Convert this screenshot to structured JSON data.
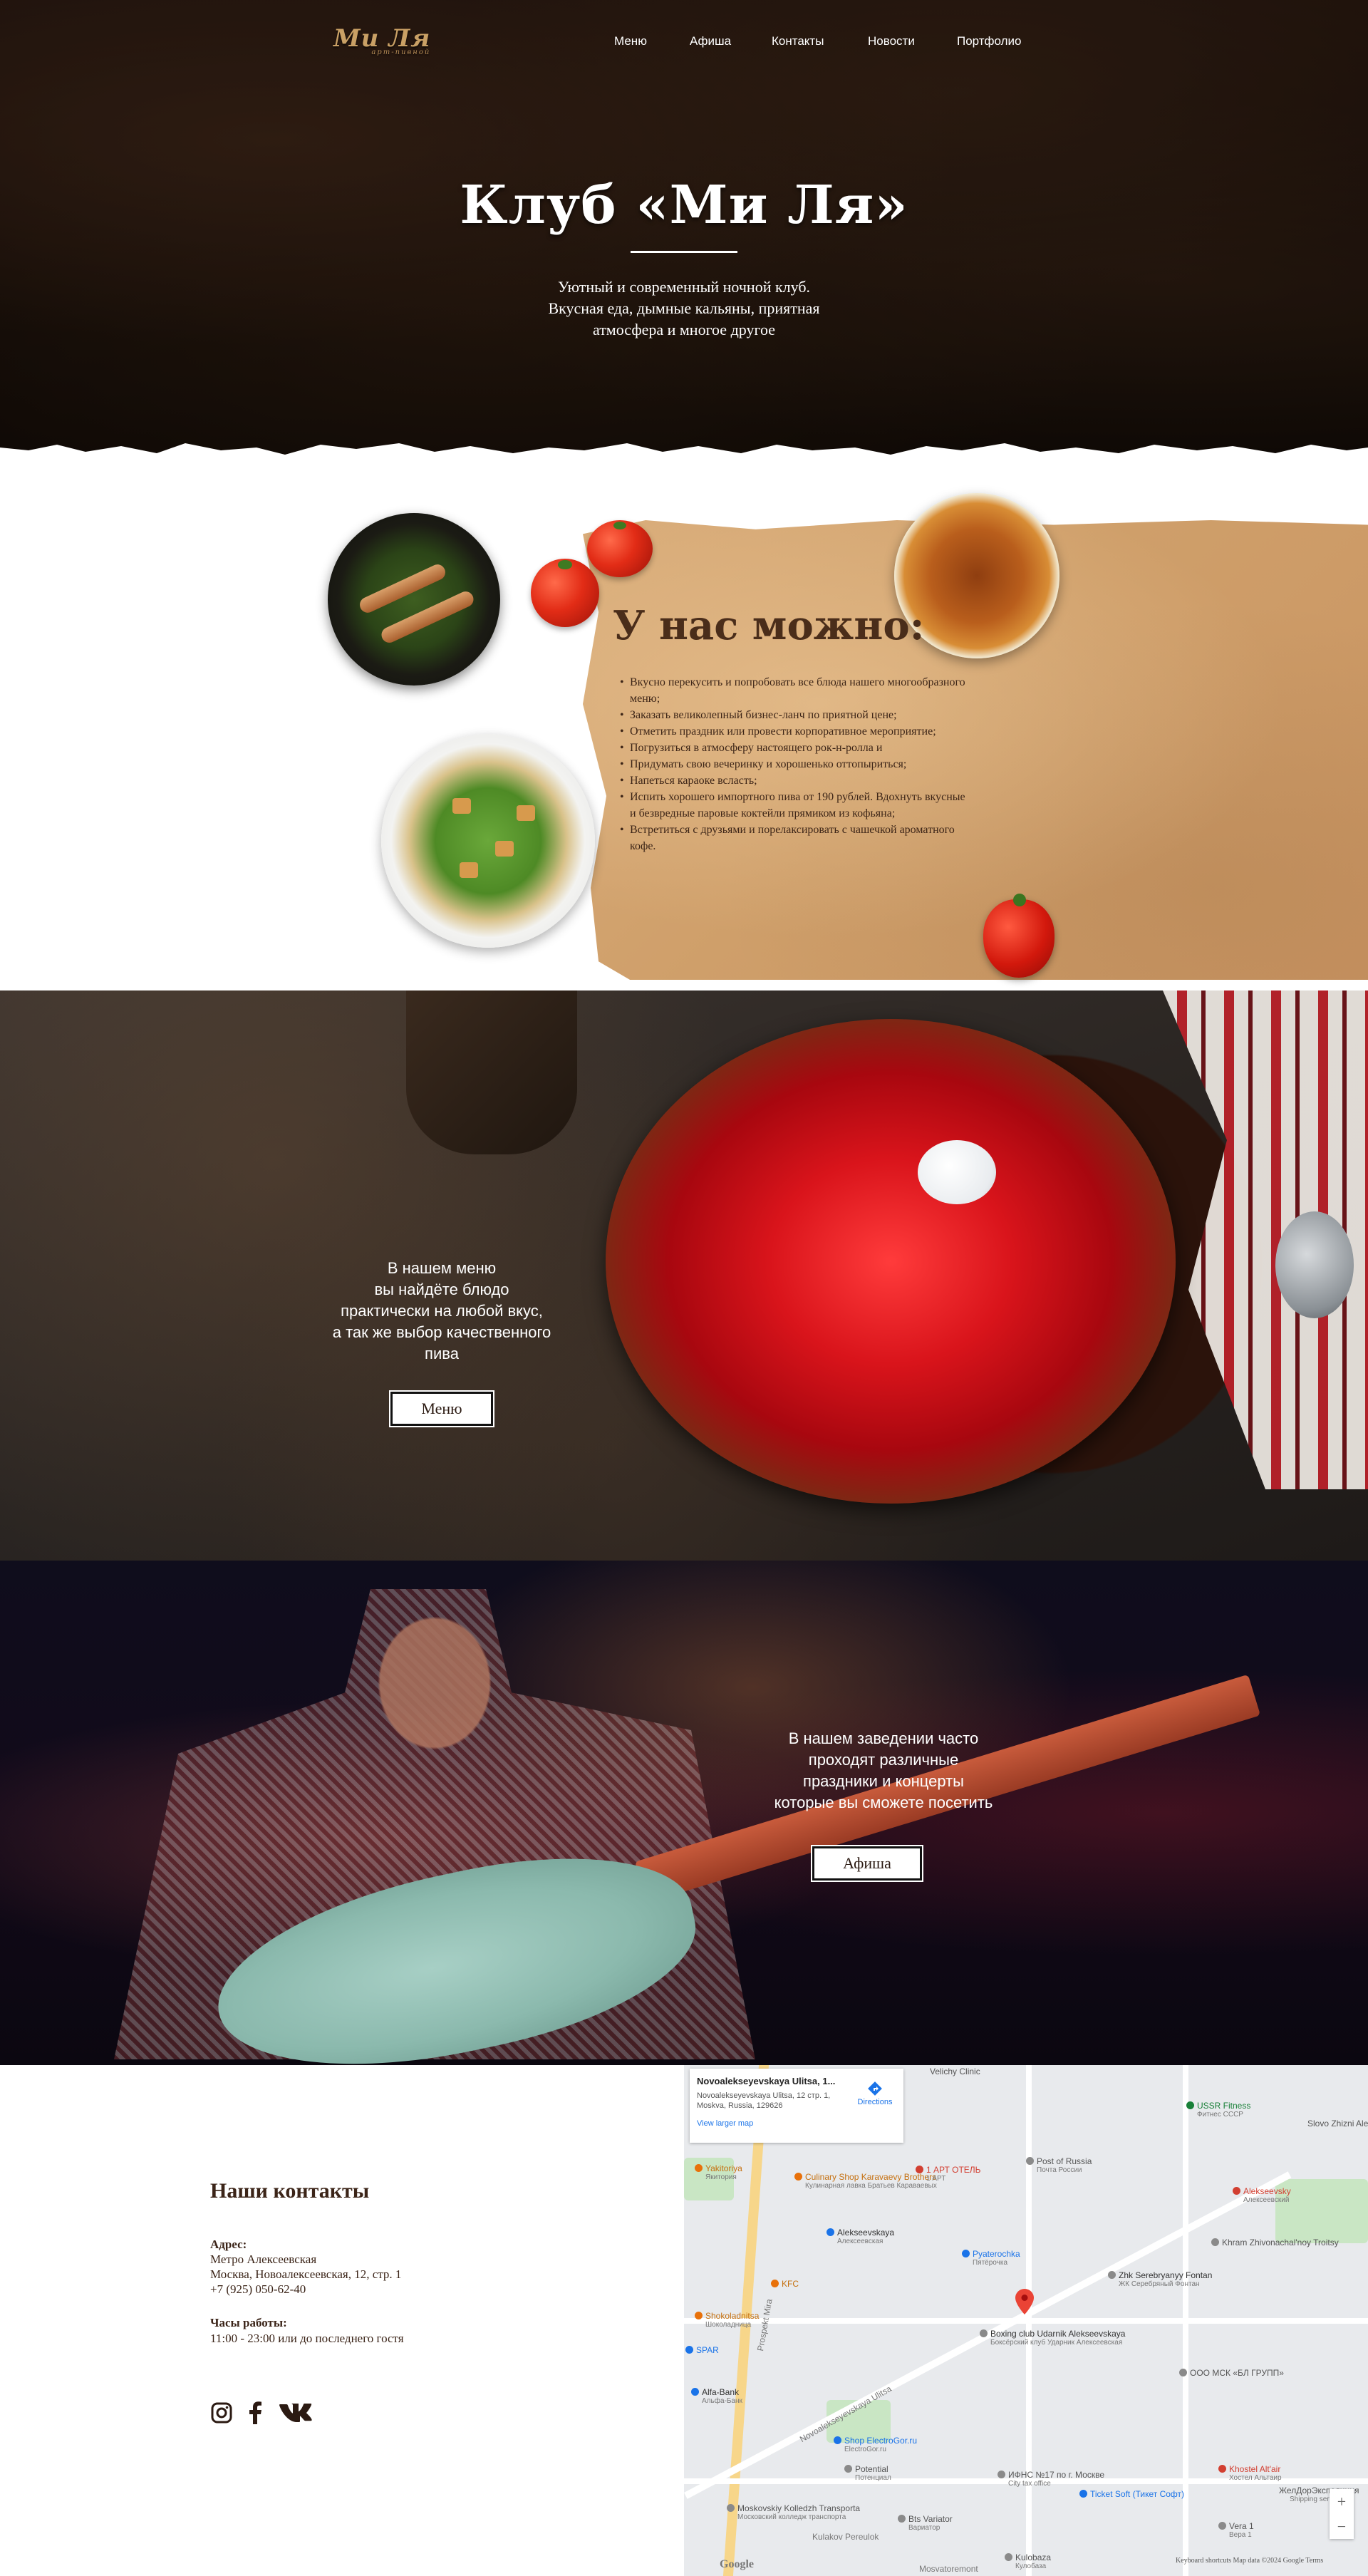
{
  "header": {
    "logo_text": "Ми Ля",
    "logo_tagline": "арт-пивной",
    "nav": [
      "Меню",
      "Афиша",
      "Контакты",
      "Новости",
      "Портфолио"
    ]
  },
  "hero": {
    "title": "Клуб «Ми Ля»",
    "subtitle": [
      "Уютный и современный ночной клуб.",
      "Вкусная еда, дымные кальяны, приятная",
      "атмосфера и многое другое"
    ]
  },
  "can": {
    "title": "У нас можно:",
    "items": [
      "Вкусно перекусить и попробовать все блюда нашего многообразного меню;",
      "Заказать великолепный бизнес-ланч по приятной цене;",
      "Отметить праздник или провести корпоративное мероприятие;",
      "Погрузиться в атмосферу настоящего рок-н-ролла и",
      "Придумать свою вечеринку и хорошенько оттопыриться;",
      "Напеться караоке всласть;",
      "Испить хорошего импортного пива от 190 рублей. Вдохнуть вкусные и безвредные паровые коктейли прямиком из кофьяна;",
      "Встретиться с друзьями и порелаксировать с чашечкой ароматного кофе."
    ]
  },
  "menu_section": {
    "text": [
      "В нашем меню",
      "вы найдёте блюдо",
      "практически на любой вкус,",
      "а так же выбор качественного",
      "пива"
    ],
    "button": "Меню"
  },
  "events_section": {
    "text": [
      "В нашем заведении часто",
      "проходят различные",
      "праздники и концерты",
      "которые вы сможете посетить"
    ],
    "button": "Афиша"
  },
  "contacts": {
    "title": "Наши контакты",
    "address_label": "Адрес:",
    "address_lines": [
      "Метро Алексеевская",
      "Москва, Новоалексеевская, 12, стр. 1",
      "+7 (925) 050-62-40"
    ],
    "hours_label": "Часы работы:",
    "hours": "11:00 - 23:00 или до последнего гостя",
    "social": [
      "instagram-icon",
      "facebook-icon",
      "vk-icon"
    ]
  },
  "map": {
    "card_title": "Novoalekseyevskaya Ulitsa, 1...",
    "card_address": "Novoalekseyevskaya Ulitsa, 12 стр. 1, Moskva, Russia, 129626",
    "card_link": "View larger map",
    "directions": "Directions",
    "pois": [
      {
        "name": "Yakitoriya",
        "sub": "Якитория"
      },
      {
        "name": "Culinary Shop Karavaevy Brothers",
        "sub": "Кулинарная лавка Братьев Караваевых"
      },
      {
        "name": "1 АРТ ОТЕЛЬ",
        "sub": "1 АРТ"
      },
      {
        "name": "Post of Russia",
        "sub": "Почта России"
      },
      {
        "name": "USSR Fitness",
        "sub": "Фитнес СССР"
      },
      {
        "name": "Alekseevskaya",
        "sub": "Алексеевская"
      },
      {
        "name": "Pyaterochka",
        "sub": "Пятёрочка"
      },
      {
        "name": "Shokoladnitsa",
        "sub": "Шоколадница"
      },
      {
        "name": "Boxing club Udarnik Alekseevskaya",
        "sub": "Боксёрский клуб Ударник Алексеевская"
      },
      {
        "name": "Zhk Serebryanyy Fontan",
        "sub": "ЖК Серебряный Фонтан"
      },
      {
        "name": "Alekseevsky",
        "sub": "Алексеевский"
      },
      {
        "name": "Khram Zhivonachal'noy Troitsy",
        "sub": ""
      },
      {
        "name": "Slovo Zhizni Alekseevsky",
        "sub": ""
      },
      {
        "name": "ООО МСК «БЛ ГРУПП»",
        "sub": ""
      },
      {
        "name": "Alfa-Bank",
        "sub": "Альфа-Банк"
      },
      {
        "name": "Shop ElectroGor.ru",
        "sub": "ElectroGor.ru"
      },
      {
        "name": "Potential",
        "sub": "Потенциал"
      },
      {
        "name": "ИФНС №17 по г. Москве",
        "sub": "City tax office"
      },
      {
        "name": "Ticket Soft (Тикет Софт)",
        "sub": ""
      },
      {
        "name": "Khostel Alt'air",
        "sub": "Хостел Альтаир"
      },
      {
        "name": "ЖелДорЭкспедиция",
        "sub": "Shipping service"
      },
      {
        "name": "Moskovskiy Kolledzh Transporta",
        "sub": "Московский колледж транспорта"
      },
      {
        "name": "Bts Variator",
        "sub": "Вариатор"
      },
      {
        "name": "Vera 1",
        "sub": "Вера 1"
      },
      {
        "name": "Kulobaza",
        "sub": "Кулобаза"
      },
      {
        "name": "KFC",
        "sub": ""
      },
      {
        "name": "SPAR",
        "sub": ""
      },
      {
        "name": "Velichy Clinic",
        "sub": ""
      }
    ],
    "street_labels": [
      "Prospekt Mira",
      "Novoalekseyevskaya Ulitsa",
      "Kulakov Pereulok",
      "Mosvatoremont"
    ],
    "footer": "Keyboard shortcuts   Map data ©2024 Google   Terms",
    "google": "Google",
    "zoom_in": "+",
    "zoom_out": "−"
  },
  "colors": {
    "accent_brown": "#3b2418",
    "kraft": "#d2a06b",
    "map_bg": "#e8eaed"
  }
}
